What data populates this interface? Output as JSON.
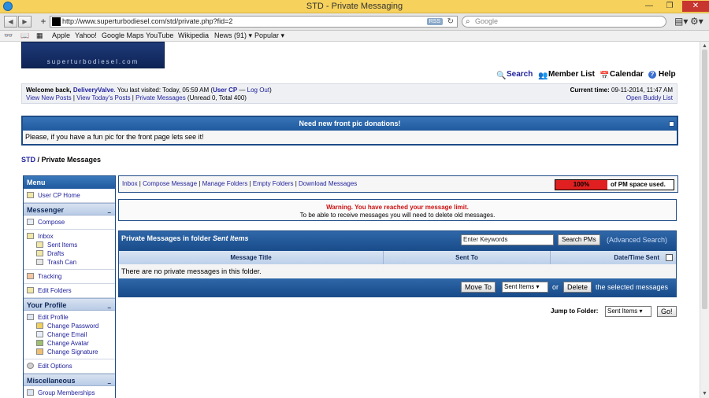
{
  "window": {
    "title": "STD - Private Messaging"
  },
  "browser": {
    "url": "http://www.superturbodiesel.com/std/private.php?fid=2",
    "rss": "RSS",
    "search_placeholder": "Google",
    "bookmarks": [
      "Apple",
      "Yahoo!",
      "Google Maps",
      "YouTube",
      "Wikipedia",
      "News (91) ▾",
      "Popular ▾"
    ]
  },
  "site": {
    "logo_text": "superturbodiesel.com",
    "toplinks": {
      "search": "Search",
      "members": "Member List",
      "calendar": "Calendar",
      "help": "Help"
    }
  },
  "welcome": {
    "prefix": "Welcome back,",
    "user": "DeliveryValve",
    "last_visit": ". You last visited: Today, 05:59 AM (",
    "user_cp": "User CP",
    "dash": " — ",
    "logout": "Log Out",
    "close": ")",
    "new_posts": "View New Posts",
    "todays_posts": "View Today's Posts",
    "private_messages": "Private Messages",
    "unread": " (Unread 0, Total 400)",
    "time_label": "Current time:",
    "time_value": " 09-11-2014, 11:47 AM",
    "buddy": "Open Buddy List",
    "sep": " | "
  },
  "notice": {
    "title": "Need new front pic donations!",
    "body": "Please, if you have a fun pic for the front page lets see it!"
  },
  "breadcrumb": {
    "root": "STD",
    "sep": " / ",
    "current": "Private Messages"
  },
  "menu": {
    "title": "Menu",
    "user_cp_home": "User CP Home",
    "messenger": "Messenger",
    "compose": "Compose",
    "inbox": "Inbox",
    "sent": "Sent Items",
    "drafts": "Drafts",
    "trash": "Trash Can",
    "tracking": "Tracking",
    "edit_folders": "Edit Folders",
    "your_profile": "Your Profile",
    "edit_profile": "Edit Profile",
    "change_password": "Change Password",
    "change_email": "Change Email",
    "change_avatar": "Change Avatar",
    "change_signature": "Change Signature",
    "edit_options": "Edit Options",
    "misc": "Miscellaneous",
    "group_membership": "Group Memberships",
    "collapse": "–"
  },
  "pmbar": {
    "inbox": "Inbox",
    "compose": "Compose Message",
    "manage": "Manage Folders",
    "empty": "Empty Folders",
    "download": "Download Messages",
    "sep": " | ",
    "usage_percent": 100,
    "usage_label": "100%",
    "usage_text": "of PM space used."
  },
  "warning": {
    "line1": "Warning. You have reached your message limit.",
    "line2": "To be able to receive messages you will need to delete old messages."
  },
  "table": {
    "title_prefix": "Private Messages in folder ",
    "folder": "Sent Items",
    "keywords": "Enter Keywords",
    "search_btn": "Search PMs",
    "advanced": "(Advanced Search)",
    "col_title": "Message Title",
    "col_sent_to": "Sent To",
    "col_date": "Date/Time Sent",
    "empty": "There are no private messages in this folder.",
    "move_to": "Move To",
    "folder_select": "Sent Items",
    "or": "or",
    "delete": "Delete",
    "selected": "the selected messages"
  },
  "jump": {
    "label": "Jump to Folder:",
    "value": "Sent Items",
    "go": "Go!"
  }
}
